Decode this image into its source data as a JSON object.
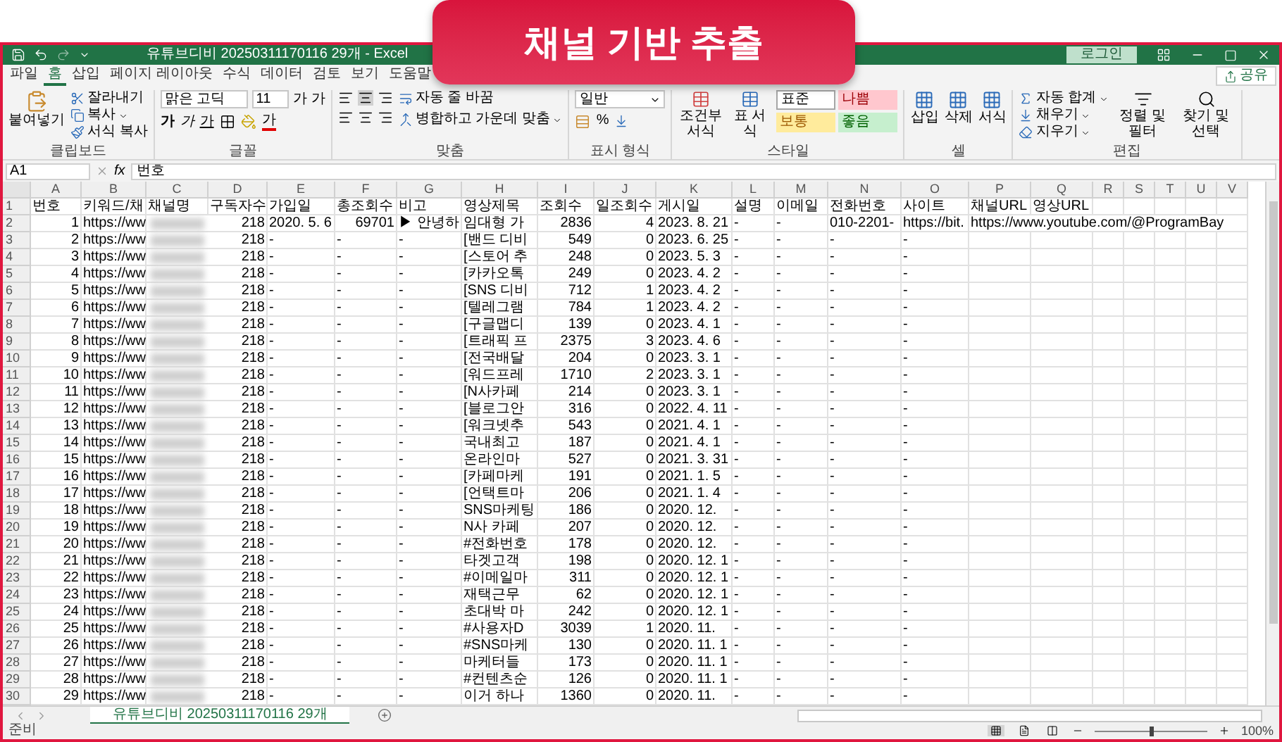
{
  "banner": {
    "title": "채널 기반 추출"
  },
  "window": {
    "title": "유튜브디비 20250311170116 29개 - Excel",
    "login": "로그인"
  },
  "menu_tabs": [
    {
      "label": "파일",
      "selected": false
    },
    {
      "label": "홈",
      "selected": true
    },
    {
      "label": "삽입",
      "selected": false
    },
    {
      "label": "페이지 레이아웃",
      "selected": false
    },
    {
      "label": "수식",
      "selected": false
    },
    {
      "label": "데이터",
      "selected": false
    },
    {
      "label": "검토",
      "selected": false
    },
    {
      "label": "보기",
      "selected": false
    },
    {
      "label": "도움말",
      "selected": false
    }
  ],
  "share": "공유",
  "ribbon": {
    "clipboard": {
      "label": "클립보드",
      "paste": "붙여넣기",
      "cut": "잘라내기",
      "copy": "복사",
      "format_painter": "서식 복사"
    },
    "font": {
      "label": "글꼴",
      "name": "맑은 고딕",
      "size": "11",
      "grow": "가",
      "shrink": "가",
      "bold": "가",
      "italic": "가",
      "underline": "가",
      "font_color_label": "가"
    },
    "alignment": {
      "label": "맞춤",
      "wrap": "자동 줄 바꿈",
      "merge": "병합하고 가운데 맞춤"
    },
    "number": {
      "label": "표시 형식",
      "format": "일반",
      "percent": "%"
    },
    "styles": {
      "label": "스타일",
      "conditional": "조건부 서식",
      "table": "표 서식",
      "cells": [
        {
          "label": "표준",
          "kind": "normal"
        },
        {
          "label": "나쁨",
          "kind": "bad"
        },
        {
          "label": "보통",
          "kind": "neutral"
        },
        {
          "label": "좋음",
          "kind": "good"
        }
      ]
    },
    "cells": {
      "label": "셀",
      "insert": "삽입",
      "delete": "삭제",
      "format": "서식"
    },
    "editing": {
      "label": "편집",
      "autosum": "자동 합계",
      "fill": "채우기",
      "clear": "지우기",
      "sort": "정렬 및 필터",
      "find": "찾기 및 선택"
    }
  },
  "formula_bar": {
    "name_box": "A1",
    "function_label": "fx",
    "value": "번호"
  },
  "sheet": {
    "columns": [
      "A",
      "B",
      "C",
      "D",
      "E",
      "F",
      "G",
      "H",
      "I",
      "J",
      "K",
      "L",
      "M",
      "N",
      "O",
      "P",
      "Q",
      "R",
      "S",
      "T",
      "U",
      "V"
    ],
    "rows": [
      {
        "header": "1",
        "cells": [
          {
            "kind": "text",
            "text": "번호"
          },
          {
            "kind": "text",
            "text": "키워드/채"
          },
          {
            "kind": "text",
            "text": "채널명"
          },
          {
            "kind": "text",
            "text": "구독자수"
          },
          {
            "kind": "text",
            "text": "가입일"
          },
          {
            "kind": "text",
            "text": "총조회수"
          },
          {
            "kind": "text",
            "text": "비고"
          },
          {
            "kind": "text",
            "text": "영상제목"
          },
          {
            "kind": "text",
            "text": "조회수"
          },
          {
            "kind": "text",
            "text": "일조회수"
          },
          {
            "kind": "text",
            "text": "게시일"
          },
          {
            "kind": "text",
            "text": "설명"
          },
          {
            "kind": "text",
            "text": "이메일"
          },
          {
            "kind": "text",
            "text": "전화번호"
          },
          {
            "kind": "text",
            "text": "사이트"
          },
          {
            "kind": "text",
            "text": "채널URL"
          },
          {
            "kind": "text",
            "text": "영상URL"
          }
        ]
      },
      {
        "header": "2",
        "cells": [
          {
            "kind": "num",
            "text": "1"
          },
          {
            "kind": "text",
            "text": "https://ww"
          },
          {
            "kind": "blur"
          },
          {
            "kind": "num",
            "text": "218"
          },
          {
            "kind": "text",
            "text": "2020. 5. 6"
          },
          {
            "kind": "num",
            "text": "69701"
          },
          {
            "kind": "text",
            "text": "▶ 안녕하"
          },
          {
            "kind": "text",
            "text": "임대형 가"
          },
          {
            "kind": "num",
            "text": "2836"
          },
          {
            "kind": "num",
            "text": "4"
          },
          {
            "kind": "text",
            "text": "2023. 8. 21"
          },
          {
            "kind": "text",
            "text": "-"
          },
          {
            "kind": "text",
            "text": "-"
          },
          {
            "kind": "text",
            "text": "010-2201-"
          },
          {
            "kind": "text",
            "text": "https://bit."
          },
          {
            "kind": "text",
            "text": "https://www.youtube.com/@ProgramBay"
          }
        ]
      },
      {
        "header": "3",
        "cells": [
          {
            "kind": "num",
            "text": "2"
          },
          {
            "kind": "text",
            "text": "https://ww"
          },
          {
            "kind": "blur"
          },
          {
            "kind": "num",
            "text": "218"
          },
          {
            "kind": "text",
            "text": "-"
          },
          {
            "kind": "text",
            "text": "-"
          },
          {
            "kind": "text",
            "text": "-"
          },
          {
            "kind": "text",
            "text": "[밴드 디비"
          },
          {
            "kind": "num",
            "text": "549"
          },
          {
            "kind": "num",
            "text": "0"
          },
          {
            "kind": "text",
            "text": "2023. 6. 25"
          },
          {
            "kind": "text",
            "text": "-"
          },
          {
            "kind": "text",
            "text": "-"
          },
          {
            "kind": "text",
            "text": "-"
          },
          {
            "kind": "text",
            "text": "-"
          }
        ]
      },
      {
        "header": "4",
        "cells": [
          {
            "kind": "num",
            "text": "3"
          },
          {
            "kind": "text",
            "text": "https://ww"
          },
          {
            "kind": "blur"
          },
          {
            "kind": "num",
            "text": "218"
          },
          {
            "kind": "text",
            "text": "-"
          },
          {
            "kind": "text",
            "text": "-"
          },
          {
            "kind": "text",
            "text": "-"
          },
          {
            "kind": "text",
            "text": "[스토어 추"
          },
          {
            "kind": "num",
            "text": "248"
          },
          {
            "kind": "num",
            "text": "0"
          },
          {
            "kind": "text",
            "text": "2023. 5. 3"
          },
          {
            "kind": "text",
            "text": "-"
          },
          {
            "kind": "text",
            "text": "-"
          },
          {
            "kind": "text",
            "text": "-"
          },
          {
            "kind": "text",
            "text": "-"
          }
        ]
      },
      {
        "header": "5",
        "cells": [
          {
            "kind": "num",
            "text": "4"
          },
          {
            "kind": "text",
            "text": "https://ww"
          },
          {
            "kind": "blur"
          },
          {
            "kind": "num",
            "text": "218"
          },
          {
            "kind": "text",
            "text": "-"
          },
          {
            "kind": "text",
            "text": "-"
          },
          {
            "kind": "text",
            "text": "-"
          },
          {
            "kind": "text",
            "text": "[카카오톡"
          },
          {
            "kind": "num",
            "text": "249"
          },
          {
            "kind": "num",
            "text": "0"
          },
          {
            "kind": "text",
            "text": "2023. 4. 2"
          },
          {
            "kind": "text",
            "text": "-"
          },
          {
            "kind": "text",
            "text": "-"
          },
          {
            "kind": "text",
            "text": "-"
          },
          {
            "kind": "text",
            "text": "-"
          }
        ]
      },
      {
        "header": "6",
        "cells": [
          {
            "kind": "num",
            "text": "5"
          },
          {
            "kind": "text",
            "text": "https://ww"
          },
          {
            "kind": "blur"
          },
          {
            "kind": "num",
            "text": "218"
          },
          {
            "kind": "text",
            "text": "-"
          },
          {
            "kind": "text",
            "text": "-"
          },
          {
            "kind": "text",
            "text": "-"
          },
          {
            "kind": "text",
            "text": "[SNS 디비"
          },
          {
            "kind": "num",
            "text": "712"
          },
          {
            "kind": "num",
            "text": "1"
          },
          {
            "kind": "text",
            "text": "2023. 4. 2"
          },
          {
            "kind": "text",
            "text": "-"
          },
          {
            "kind": "text",
            "text": "-"
          },
          {
            "kind": "text",
            "text": "-"
          },
          {
            "kind": "text",
            "text": "-"
          }
        ]
      },
      {
        "header": "7",
        "cells": [
          {
            "kind": "num",
            "text": "6"
          },
          {
            "kind": "text",
            "text": "https://ww"
          },
          {
            "kind": "blur"
          },
          {
            "kind": "num",
            "text": "218"
          },
          {
            "kind": "text",
            "text": "-"
          },
          {
            "kind": "text",
            "text": "-"
          },
          {
            "kind": "text",
            "text": "-"
          },
          {
            "kind": "text",
            "text": "[텔레그램"
          },
          {
            "kind": "num",
            "text": "784"
          },
          {
            "kind": "num",
            "text": "1"
          },
          {
            "kind": "text",
            "text": "2023. 4. 2"
          },
          {
            "kind": "text",
            "text": "-"
          },
          {
            "kind": "text",
            "text": "-"
          },
          {
            "kind": "text",
            "text": "-"
          },
          {
            "kind": "text",
            "text": "-"
          }
        ]
      },
      {
        "header": "8",
        "cells": [
          {
            "kind": "num",
            "text": "7"
          },
          {
            "kind": "text",
            "text": "https://ww"
          },
          {
            "kind": "blur"
          },
          {
            "kind": "num",
            "text": "218"
          },
          {
            "kind": "text",
            "text": "-"
          },
          {
            "kind": "text",
            "text": "-"
          },
          {
            "kind": "text",
            "text": "-"
          },
          {
            "kind": "text",
            "text": "[구글맵디"
          },
          {
            "kind": "num",
            "text": "139"
          },
          {
            "kind": "num",
            "text": "0"
          },
          {
            "kind": "text",
            "text": "2023. 4. 1"
          },
          {
            "kind": "text",
            "text": "-"
          },
          {
            "kind": "text",
            "text": "-"
          },
          {
            "kind": "text",
            "text": "-"
          },
          {
            "kind": "text",
            "text": "-"
          }
        ]
      },
      {
        "header": "9",
        "cells": [
          {
            "kind": "num",
            "text": "8"
          },
          {
            "kind": "text",
            "text": "https://ww"
          },
          {
            "kind": "blur"
          },
          {
            "kind": "num",
            "text": "218"
          },
          {
            "kind": "text",
            "text": "-"
          },
          {
            "kind": "text",
            "text": "-"
          },
          {
            "kind": "text",
            "text": "-"
          },
          {
            "kind": "text",
            "text": "[트래픽 프"
          },
          {
            "kind": "num",
            "text": "2375"
          },
          {
            "kind": "num",
            "text": "3"
          },
          {
            "kind": "text",
            "text": "2023. 4. 6"
          },
          {
            "kind": "text",
            "text": "-"
          },
          {
            "kind": "text",
            "text": "-"
          },
          {
            "kind": "text",
            "text": "-"
          },
          {
            "kind": "text",
            "text": "-"
          }
        ]
      },
      {
        "header": "10",
        "cells": [
          {
            "kind": "num",
            "text": "9"
          },
          {
            "kind": "text",
            "text": "https://ww"
          },
          {
            "kind": "blur"
          },
          {
            "kind": "num",
            "text": "218"
          },
          {
            "kind": "text",
            "text": "-"
          },
          {
            "kind": "text",
            "text": "-"
          },
          {
            "kind": "text",
            "text": "-"
          },
          {
            "kind": "text",
            "text": "[전국배달"
          },
          {
            "kind": "num",
            "text": "204"
          },
          {
            "kind": "num",
            "text": "0"
          },
          {
            "kind": "text",
            "text": "2023. 3. 1"
          },
          {
            "kind": "text",
            "text": "-"
          },
          {
            "kind": "text",
            "text": "-"
          },
          {
            "kind": "text",
            "text": "-"
          },
          {
            "kind": "text",
            "text": "-"
          }
        ]
      },
      {
        "header": "11",
        "cells": [
          {
            "kind": "num",
            "text": "10"
          },
          {
            "kind": "text",
            "text": "https://ww"
          },
          {
            "kind": "blur"
          },
          {
            "kind": "num",
            "text": "218"
          },
          {
            "kind": "text",
            "text": "-"
          },
          {
            "kind": "text",
            "text": "-"
          },
          {
            "kind": "text",
            "text": "-"
          },
          {
            "kind": "text",
            "text": "[워드프레"
          },
          {
            "kind": "num",
            "text": "1710"
          },
          {
            "kind": "num",
            "text": "2"
          },
          {
            "kind": "text",
            "text": "2023. 3. 1"
          },
          {
            "kind": "text",
            "text": "-"
          },
          {
            "kind": "text",
            "text": "-"
          },
          {
            "kind": "text",
            "text": "-"
          },
          {
            "kind": "text",
            "text": "-"
          }
        ]
      },
      {
        "header": "12",
        "cells": [
          {
            "kind": "num",
            "text": "11"
          },
          {
            "kind": "text",
            "text": "https://ww"
          },
          {
            "kind": "blur"
          },
          {
            "kind": "num",
            "text": "218"
          },
          {
            "kind": "text",
            "text": "-"
          },
          {
            "kind": "text",
            "text": "-"
          },
          {
            "kind": "text",
            "text": "-"
          },
          {
            "kind": "text",
            "text": "[N사카페"
          },
          {
            "kind": "num",
            "text": "214"
          },
          {
            "kind": "num",
            "text": "0"
          },
          {
            "kind": "text",
            "text": "2023. 3. 1"
          },
          {
            "kind": "text",
            "text": "-"
          },
          {
            "kind": "text",
            "text": "-"
          },
          {
            "kind": "text",
            "text": "-"
          },
          {
            "kind": "text",
            "text": "-"
          }
        ]
      },
      {
        "header": "13",
        "cells": [
          {
            "kind": "num",
            "text": "12"
          },
          {
            "kind": "text",
            "text": "https://ww"
          },
          {
            "kind": "blur"
          },
          {
            "kind": "num",
            "text": "218"
          },
          {
            "kind": "text",
            "text": "-"
          },
          {
            "kind": "text",
            "text": "-"
          },
          {
            "kind": "text",
            "text": "-"
          },
          {
            "kind": "text",
            "text": "[블로그안"
          },
          {
            "kind": "num",
            "text": "316"
          },
          {
            "kind": "num",
            "text": "0"
          },
          {
            "kind": "text",
            "text": "2022. 4. 11"
          },
          {
            "kind": "text",
            "text": "-"
          },
          {
            "kind": "text",
            "text": "-"
          },
          {
            "kind": "text",
            "text": "-"
          },
          {
            "kind": "text",
            "text": "-"
          }
        ]
      },
      {
        "header": "14",
        "cells": [
          {
            "kind": "num",
            "text": "13"
          },
          {
            "kind": "text",
            "text": "https://ww"
          },
          {
            "kind": "blur"
          },
          {
            "kind": "num",
            "text": "218"
          },
          {
            "kind": "text",
            "text": "-"
          },
          {
            "kind": "text",
            "text": "-"
          },
          {
            "kind": "text",
            "text": "-"
          },
          {
            "kind": "text",
            "text": "[워크넷추"
          },
          {
            "kind": "num",
            "text": "543"
          },
          {
            "kind": "num",
            "text": "0"
          },
          {
            "kind": "text",
            "text": "2021. 4. 1"
          },
          {
            "kind": "text",
            "text": "-"
          },
          {
            "kind": "text",
            "text": "-"
          },
          {
            "kind": "text",
            "text": "-"
          },
          {
            "kind": "text",
            "text": "-"
          }
        ]
      },
      {
        "header": "15",
        "cells": [
          {
            "kind": "num",
            "text": "14"
          },
          {
            "kind": "text",
            "text": "https://ww"
          },
          {
            "kind": "blur"
          },
          {
            "kind": "num",
            "text": "218"
          },
          {
            "kind": "text",
            "text": "-"
          },
          {
            "kind": "text",
            "text": "-"
          },
          {
            "kind": "text",
            "text": "-"
          },
          {
            "kind": "text",
            "text": "국내최고"
          },
          {
            "kind": "num",
            "text": "187"
          },
          {
            "kind": "num",
            "text": "0"
          },
          {
            "kind": "text",
            "text": "2021. 4. 1"
          },
          {
            "kind": "text",
            "text": "-"
          },
          {
            "kind": "text",
            "text": "-"
          },
          {
            "kind": "text",
            "text": "-"
          },
          {
            "kind": "text",
            "text": "-"
          }
        ]
      },
      {
        "header": "16",
        "cells": [
          {
            "kind": "num",
            "text": "15"
          },
          {
            "kind": "text",
            "text": "https://ww"
          },
          {
            "kind": "blur"
          },
          {
            "kind": "num",
            "text": "218"
          },
          {
            "kind": "text",
            "text": "-"
          },
          {
            "kind": "text",
            "text": "-"
          },
          {
            "kind": "text",
            "text": "-"
          },
          {
            "kind": "text",
            "text": "온라인마"
          },
          {
            "kind": "num",
            "text": "527"
          },
          {
            "kind": "num",
            "text": "0"
          },
          {
            "kind": "text",
            "text": "2021. 3. 31"
          },
          {
            "kind": "text",
            "text": "-"
          },
          {
            "kind": "text",
            "text": "-"
          },
          {
            "kind": "text",
            "text": "-"
          },
          {
            "kind": "text",
            "text": "-"
          }
        ]
      },
      {
        "header": "17",
        "cells": [
          {
            "kind": "num",
            "text": "16"
          },
          {
            "kind": "text",
            "text": "https://ww"
          },
          {
            "kind": "blur"
          },
          {
            "kind": "num",
            "text": "218"
          },
          {
            "kind": "text",
            "text": "-"
          },
          {
            "kind": "text",
            "text": "-"
          },
          {
            "kind": "text",
            "text": "-"
          },
          {
            "kind": "text",
            "text": "[카페마케"
          },
          {
            "kind": "num",
            "text": "191"
          },
          {
            "kind": "num",
            "text": "0"
          },
          {
            "kind": "text",
            "text": "2021. 1. 5"
          },
          {
            "kind": "text",
            "text": "-"
          },
          {
            "kind": "text",
            "text": "-"
          },
          {
            "kind": "text",
            "text": "-"
          },
          {
            "kind": "text",
            "text": "-"
          }
        ]
      },
      {
        "header": "18",
        "cells": [
          {
            "kind": "num",
            "text": "17"
          },
          {
            "kind": "text",
            "text": "https://ww"
          },
          {
            "kind": "blur"
          },
          {
            "kind": "num",
            "text": "218"
          },
          {
            "kind": "text",
            "text": "-"
          },
          {
            "kind": "text",
            "text": "-"
          },
          {
            "kind": "text",
            "text": "-"
          },
          {
            "kind": "text",
            "text": "[언택트마"
          },
          {
            "kind": "num",
            "text": "206"
          },
          {
            "kind": "num",
            "text": "0"
          },
          {
            "kind": "text",
            "text": "2021. 1. 4"
          },
          {
            "kind": "text",
            "text": "-"
          },
          {
            "kind": "text",
            "text": "-"
          },
          {
            "kind": "text",
            "text": "-"
          },
          {
            "kind": "text",
            "text": "-"
          }
        ]
      },
      {
        "header": "19",
        "cells": [
          {
            "kind": "num",
            "text": "18"
          },
          {
            "kind": "text",
            "text": "https://ww"
          },
          {
            "kind": "blur"
          },
          {
            "kind": "num",
            "text": "218"
          },
          {
            "kind": "text",
            "text": "-"
          },
          {
            "kind": "text",
            "text": "-"
          },
          {
            "kind": "text",
            "text": "-"
          },
          {
            "kind": "text",
            "text": "SNS마케팅"
          },
          {
            "kind": "num",
            "text": "186"
          },
          {
            "kind": "num",
            "text": "0"
          },
          {
            "kind": "text",
            "text": "2020. 12."
          },
          {
            "kind": "text",
            "text": "-"
          },
          {
            "kind": "text",
            "text": "-"
          },
          {
            "kind": "text",
            "text": "-"
          },
          {
            "kind": "text",
            "text": "-"
          }
        ]
      },
      {
        "header": "20",
        "cells": [
          {
            "kind": "num",
            "text": "19"
          },
          {
            "kind": "text",
            "text": "https://ww"
          },
          {
            "kind": "blur"
          },
          {
            "kind": "num",
            "text": "218"
          },
          {
            "kind": "text",
            "text": "-"
          },
          {
            "kind": "text",
            "text": "-"
          },
          {
            "kind": "text",
            "text": "-"
          },
          {
            "kind": "text",
            "text": "N사 카페"
          },
          {
            "kind": "num",
            "text": "207"
          },
          {
            "kind": "num",
            "text": "0"
          },
          {
            "kind": "text",
            "text": "2020. 12."
          },
          {
            "kind": "text",
            "text": "-"
          },
          {
            "kind": "text",
            "text": "-"
          },
          {
            "kind": "text",
            "text": "-"
          },
          {
            "kind": "text",
            "text": "-"
          }
        ]
      },
      {
        "header": "21",
        "cells": [
          {
            "kind": "num",
            "text": "20"
          },
          {
            "kind": "text",
            "text": "https://ww"
          },
          {
            "kind": "blur"
          },
          {
            "kind": "num",
            "text": "218"
          },
          {
            "kind": "text",
            "text": "-"
          },
          {
            "kind": "text",
            "text": "-"
          },
          {
            "kind": "text",
            "text": "-"
          },
          {
            "kind": "text",
            "text": "#전화번호"
          },
          {
            "kind": "num",
            "text": "178"
          },
          {
            "kind": "num",
            "text": "0"
          },
          {
            "kind": "text",
            "text": "2020. 12."
          },
          {
            "kind": "text",
            "text": "-"
          },
          {
            "kind": "text",
            "text": "-"
          },
          {
            "kind": "text",
            "text": "-"
          },
          {
            "kind": "text",
            "text": "-"
          }
        ]
      },
      {
        "header": "22",
        "cells": [
          {
            "kind": "num",
            "text": "21"
          },
          {
            "kind": "text",
            "text": "https://ww"
          },
          {
            "kind": "blur"
          },
          {
            "kind": "num",
            "text": "218"
          },
          {
            "kind": "text",
            "text": "-"
          },
          {
            "kind": "text",
            "text": "-"
          },
          {
            "kind": "text",
            "text": "-"
          },
          {
            "kind": "text",
            "text": "타겟고객"
          },
          {
            "kind": "num",
            "text": "198"
          },
          {
            "kind": "num",
            "text": "0"
          },
          {
            "kind": "text",
            "text": "2020. 12. 1"
          },
          {
            "kind": "text",
            "text": "-"
          },
          {
            "kind": "text",
            "text": "-"
          },
          {
            "kind": "text",
            "text": "-"
          },
          {
            "kind": "text",
            "text": "-"
          }
        ]
      },
      {
        "header": "23",
        "cells": [
          {
            "kind": "num",
            "text": "22"
          },
          {
            "kind": "text",
            "text": "https://ww"
          },
          {
            "kind": "blur"
          },
          {
            "kind": "num",
            "text": "218"
          },
          {
            "kind": "text",
            "text": "-"
          },
          {
            "kind": "text",
            "text": "-"
          },
          {
            "kind": "text",
            "text": "-"
          },
          {
            "kind": "text",
            "text": "#이메일마"
          },
          {
            "kind": "num",
            "text": "311"
          },
          {
            "kind": "num",
            "text": "0"
          },
          {
            "kind": "text",
            "text": "2020. 12. 1"
          },
          {
            "kind": "text",
            "text": "-"
          },
          {
            "kind": "text",
            "text": "-"
          },
          {
            "kind": "text",
            "text": "-"
          },
          {
            "kind": "text",
            "text": "-"
          }
        ]
      },
      {
        "header": "24",
        "cells": [
          {
            "kind": "num",
            "text": "23"
          },
          {
            "kind": "text",
            "text": "https://ww"
          },
          {
            "kind": "blur"
          },
          {
            "kind": "num",
            "text": "218"
          },
          {
            "kind": "text",
            "text": "-"
          },
          {
            "kind": "text",
            "text": "-"
          },
          {
            "kind": "text",
            "text": "-"
          },
          {
            "kind": "text",
            "text": "재택근무"
          },
          {
            "kind": "num",
            "text": "62"
          },
          {
            "kind": "num",
            "text": "0"
          },
          {
            "kind": "text",
            "text": "2020. 12. 1"
          },
          {
            "kind": "text",
            "text": "-"
          },
          {
            "kind": "text",
            "text": "-"
          },
          {
            "kind": "text",
            "text": "-"
          },
          {
            "kind": "text",
            "text": "-"
          }
        ]
      },
      {
        "header": "25",
        "cells": [
          {
            "kind": "num",
            "text": "24"
          },
          {
            "kind": "text",
            "text": "https://ww"
          },
          {
            "kind": "blur"
          },
          {
            "kind": "num",
            "text": "218"
          },
          {
            "kind": "text",
            "text": "-"
          },
          {
            "kind": "text",
            "text": "-"
          },
          {
            "kind": "text",
            "text": "-"
          },
          {
            "kind": "text",
            "text": "초대박 마"
          },
          {
            "kind": "num",
            "text": "242"
          },
          {
            "kind": "num",
            "text": "0"
          },
          {
            "kind": "text",
            "text": "2020. 12. 1"
          },
          {
            "kind": "text",
            "text": "-"
          },
          {
            "kind": "text",
            "text": "-"
          },
          {
            "kind": "text",
            "text": "-"
          },
          {
            "kind": "text",
            "text": "-"
          }
        ]
      },
      {
        "header": "26",
        "cells": [
          {
            "kind": "num",
            "text": "25"
          },
          {
            "kind": "text",
            "text": "https://ww"
          },
          {
            "kind": "blur"
          },
          {
            "kind": "num",
            "text": "218"
          },
          {
            "kind": "text",
            "text": "-"
          },
          {
            "kind": "text",
            "text": "-"
          },
          {
            "kind": "text",
            "text": "-"
          },
          {
            "kind": "text",
            "text": "#사용자D"
          },
          {
            "kind": "num",
            "text": "3039"
          },
          {
            "kind": "num",
            "text": "1"
          },
          {
            "kind": "text",
            "text": "2020. 11."
          },
          {
            "kind": "text",
            "text": "-"
          },
          {
            "kind": "text",
            "text": "-"
          },
          {
            "kind": "text",
            "text": "-"
          },
          {
            "kind": "text",
            "text": "-"
          }
        ]
      },
      {
        "header": "27",
        "cells": [
          {
            "kind": "num",
            "text": "26"
          },
          {
            "kind": "text",
            "text": "https://ww"
          },
          {
            "kind": "blur"
          },
          {
            "kind": "num",
            "text": "218"
          },
          {
            "kind": "text",
            "text": "-"
          },
          {
            "kind": "text",
            "text": "-"
          },
          {
            "kind": "text",
            "text": "-"
          },
          {
            "kind": "text",
            "text": "#SNS마케"
          },
          {
            "kind": "num",
            "text": "130"
          },
          {
            "kind": "num",
            "text": "0"
          },
          {
            "kind": "text",
            "text": "2020. 11. 1"
          },
          {
            "kind": "text",
            "text": "-"
          },
          {
            "kind": "text",
            "text": "-"
          },
          {
            "kind": "text",
            "text": "-"
          },
          {
            "kind": "text",
            "text": "-"
          }
        ]
      },
      {
        "header": "28",
        "cells": [
          {
            "kind": "num",
            "text": "27"
          },
          {
            "kind": "text",
            "text": "https://ww"
          },
          {
            "kind": "blur"
          },
          {
            "kind": "num",
            "text": "218"
          },
          {
            "kind": "text",
            "text": "-"
          },
          {
            "kind": "text",
            "text": "-"
          },
          {
            "kind": "text",
            "text": "-"
          },
          {
            "kind": "text",
            "text": "마케터들"
          },
          {
            "kind": "num",
            "text": "173"
          },
          {
            "kind": "num",
            "text": "0"
          },
          {
            "kind": "text",
            "text": "2020. 11. 1"
          },
          {
            "kind": "text",
            "text": "-"
          },
          {
            "kind": "text",
            "text": "-"
          },
          {
            "kind": "text",
            "text": "-"
          },
          {
            "kind": "text",
            "text": "-"
          }
        ]
      },
      {
        "header": "29",
        "cells": [
          {
            "kind": "num",
            "text": "28"
          },
          {
            "kind": "text",
            "text": "https://ww"
          },
          {
            "kind": "blur"
          },
          {
            "kind": "num",
            "text": "218"
          },
          {
            "kind": "text",
            "text": "-"
          },
          {
            "kind": "text",
            "text": "-"
          },
          {
            "kind": "text",
            "text": "-"
          },
          {
            "kind": "text",
            "text": "#컨텐츠순"
          },
          {
            "kind": "num",
            "text": "126"
          },
          {
            "kind": "num",
            "text": "0"
          },
          {
            "kind": "text",
            "text": "2020. 11. 1"
          },
          {
            "kind": "text",
            "text": "-"
          },
          {
            "kind": "text",
            "text": "-"
          },
          {
            "kind": "text",
            "text": "-"
          },
          {
            "kind": "text",
            "text": "-"
          }
        ]
      },
      {
        "header": "30",
        "cells": [
          {
            "kind": "num",
            "text": "29"
          },
          {
            "kind": "text",
            "text": "https://ww"
          },
          {
            "kind": "blur"
          },
          {
            "kind": "num",
            "text": "218"
          },
          {
            "kind": "text",
            "text": "-"
          },
          {
            "kind": "text",
            "text": "-"
          },
          {
            "kind": "text",
            "text": "-"
          },
          {
            "kind": "text",
            "text": "이거 하나"
          },
          {
            "kind": "num",
            "text": "1360"
          },
          {
            "kind": "num",
            "text": "0"
          },
          {
            "kind": "text",
            "text": "2020. 11."
          },
          {
            "kind": "text",
            "text": "-"
          },
          {
            "kind": "text",
            "text": "-"
          },
          {
            "kind": "text",
            "text": "-"
          },
          {
            "kind": "text",
            "text": "-"
          }
        ]
      }
    ]
  },
  "sheet_tabs": [
    {
      "label": "유튜브디비 20250311170116 29개",
      "selected": true
    }
  ],
  "status_bar": {
    "text": "준비",
    "views": [
      {
        "kind": "normal",
        "selected": true
      },
      {
        "kind": "page_layout",
        "selected": false
      },
      {
        "kind": "page_break",
        "selected": false
      }
    ],
    "zoom": {
      "level": 0.5,
      "reading": "100%"
    }
  }
}
